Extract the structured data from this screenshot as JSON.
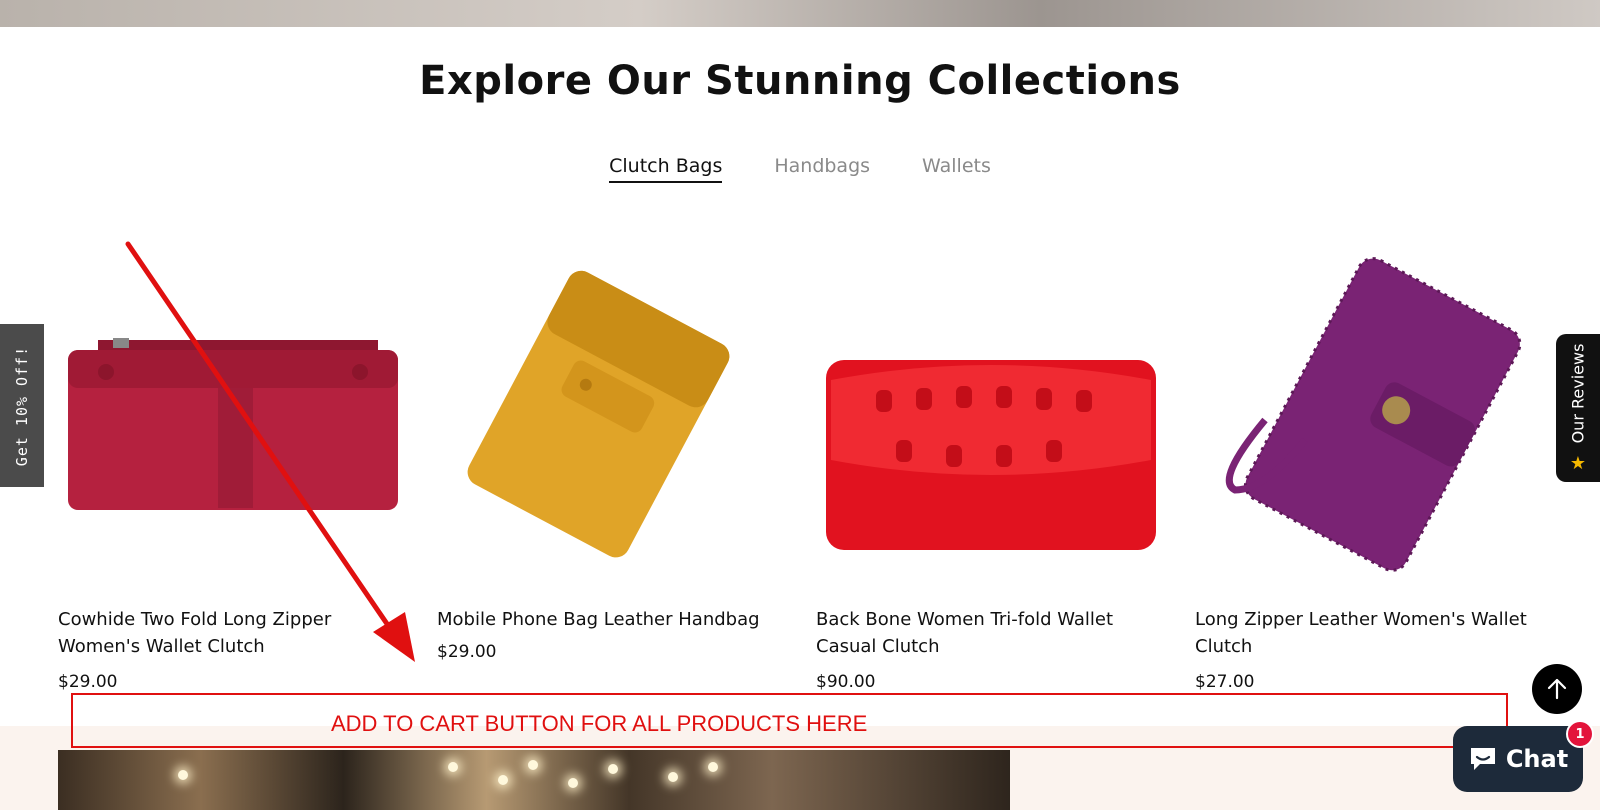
{
  "section": {
    "heading": "Explore Our Stunning Collections",
    "tabs": [
      {
        "label": "Clutch Bags",
        "active": true
      },
      {
        "label": "Handbags",
        "active": false
      },
      {
        "label": "Wallets",
        "active": false
      }
    ]
  },
  "products": [
    {
      "title": "Cowhide Two Fold Long Zipper Women's Wallet Clutch",
      "price": "$29.00",
      "color": "#b5213f"
    },
    {
      "title": "Mobile Phone Bag Leather Handbag",
      "price": "$29.00",
      "color": "#e0a428"
    },
    {
      "title": "Back Bone Women Tri-fold Wallet Casual Clutch",
      "price": "$90.00",
      "color": "#e1121f"
    },
    {
      "title": "Long Zipper Leather Women's Wallet Clutch",
      "price": "$27.00",
      "color": "#7a2374"
    }
  ],
  "side_tab": {
    "label": "Get 10% Off!"
  },
  "reviews_tab": {
    "label": "Our Reviews",
    "icon": "star-icon"
  },
  "annotation": {
    "text": "ADD TO CART BUTTON FOR ALL PRODUCTS HERE",
    "color": "#e01010"
  },
  "chat_widget": {
    "label": "Chat",
    "badge": "1",
    "icon": "chat-bubble-icon"
  },
  "scroll_top": {
    "icon": "arrow-up-icon"
  }
}
